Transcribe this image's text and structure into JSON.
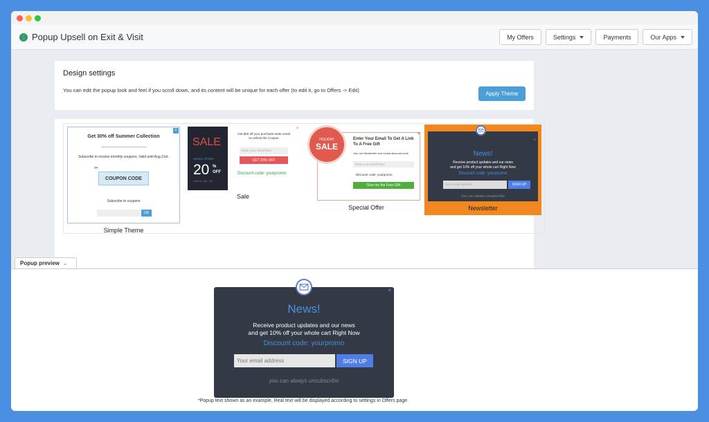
{
  "app": {
    "title": "Popup Upsell on Exit & Visit",
    "nav": [
      {
        "label": "My Offers",
        "dropdown": false
      },
      {
        "label": "Settings",
        "dropdown": true
      },
      {
        "label": "Payments",
        "dropdown": false
      },
      {
        "label": "Our Apps",
        "dropdown": true
      }
    ]
  },
  "design": {
    "title": "Design settings",
    "description": "You can edit the popup look and feel if you scroll down, and its content will be unique for each offer (to edit it, go to Offers -> Edit)",
    "apply_button": "Apply Theme"
  },
  "themes": {
    "simple": {
      "label": "Simple Theme",
      "heading": "Get 30% off Summer Collection",
      "subtext": "Subscribe to receive monthly coupons. Valid until Aug.31st.",
      "coupon": "COUPON CODE",
      "subscribe": "Subscribe to coupons",
      "ok": "OK",
      "close": "×"
    },
    "sale": {
      "label": "Sale",
      "sale_word": "SALE",
      "whole_store": "WHOLE STORE",
      "big_number": "20",
      "pct": "%",
      "off": "OFF",
      "valid": "valid to Jan. 3rd",
      "text": "Get $20 off your purchase enter email to Unlock the Coupon",
      "input_placeholder": "Enter your email here",
      "button": "GET 20% OFF",
      "discount": "Discount code: yourpromo",
      "close": "×"
    },
    "special": {
      "label": "Special Offer",
      "badge_top": "HOLIDAY",
      "badge_main": "SALE",
      "title": "Enter Your Email To Get A Link To A Free Gift",
      "sub": "Join our Newsletter and reveal discount code",
      "input_placeholder": "Enter your email here",
      "code": "Discount code: yourpromo",
      "button": "Give me the Free Gift!",
      "close": "×"
    },
    "newsletter": {
      "label": "Newsletter",
      "heading": "News!",
      "text_line1": "Receive product updates and our news",
      "text_line2": "and get 10% off your whole cart Right Now",
      "discount": "Discount code: yourpromo",
      "input_placeholder": "Your email address",
      "button": "SIGN UP",
      "unsubscribe": "you can always unsubscribe",
      "close": "×",
      "accent": "#f0871f"
    }
  },
  "preview": {
    "tab_label": "Popup preview",
    "heading": "News!",
    "text_line1": "Receive product updates and our news",
    "text_line2": "and get 10% off your whole cart Right Now",
    "discount": "Discount code: yourpromo",
    "input_placeholder": "Your email address",
    "button": "SIGN UP",
    "unsubscribe": "you can always unsubscribe",
    "close": "×",
    "note": "*Popup text shown as an example. Real text will be displayed according to settings in Offers page"
  }
}
